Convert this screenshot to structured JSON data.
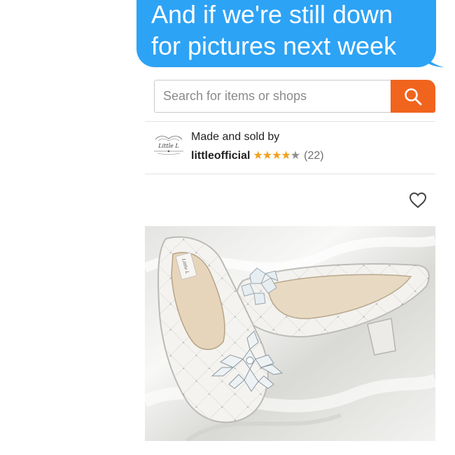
{
  "message": {
    "line1": "And if we're still down",
    "line2": "for pictures next week",
    "bubble_color": "#2da3f5"
  },
  "search": {
    "placeholder": "Search for items or shops",
    "button_color": "#f1641e",
    "icon": "search-icon"
  },
  "shop": {
    "made_label": "Made and sold by",
    "name": "littleofficial",
    "stars_filled": "★★★★",
    "stars_empty": "★",
    "rating": 4,
    "rating_max": 5,
    "review_count": "(22)",
    "logo_icon": "shop-logo",
    "logo_text": "Little L"
  },
  "listing": {
    "favorite_icon": "heart-outline-icon",
    "image_subject": "product-image",
    "shoe_label_text": "Little L"
  }
}
